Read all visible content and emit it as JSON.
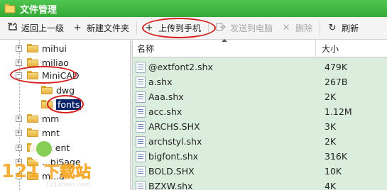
{
  "app": {
    "title": "文件管理"
  },
  "toolbar": {
    "back": {
      "icon": "back-icon",
      "label": "返回上一级"
    },
    "new_folder": {
      "icon": "plus-icon",
      "label": "新建文件夹"
    },
    "upload": {
      "icon": "plus-icon",
      "label": "上传到手机"
    },
    "send_pc": {
      "icon": "send-icon",
      "label": "发送到电脑"
    },
    "delete": {
      "icon": "close-icon",
      "label": "删除"
    },
    "refresh": {
      "icon": "refresh-icon",
      "label": "刷新"
    }
  },
  "tree": {
    "items": [
      {
        "label": "mihui",
        "expander": "+"
      },
      {
        "label": "miliao",
        "expander": "+"
      },
      {
        "label": "MiniCAD",
        "expander": "−"
      },
      {
        "label": "dwg",
        "expander": ""
      },
      {
        "label": "fonts",
        "expander": "",
        "selected": true
      },
      {
        "label": "mm",
        "expander": "+"
      },
      {
        "label": "mnt",
        "expander": "+"
      },
      {
        "label": "...cent",
        "expander": "+"
      },
      {
        "label": "...biSage",
        "expander": "+"
      },
      {
        "label": "m...a",
        "expander": "+"
      }
    ]
  },
  "files": {
    "columns": {
      "name": "名称",
      "size": "大小"
    },
    "rows": [
      {
        "name": "@extfont2.shx",
        "size": "479K"
      },
      {
        "name": "a.shx",
        "size": "267B"
      },
      {
        "name": "Aaa.shx",
        "size": "2K"
      },
      {
        "name": "acc.shx",
        "size": "1.12M"
      },
      {
        "name": "ARCHS.SHX",
        "size": "3K"
      },
      {
        "name": "archstyl.shx",
        "size": "2K"
      },
      {
        "name": "bigfont.shx",
        "size": "316K"
      },
      {
        "name": "BOLD.SHX",
        "size": "10K"
      },
      {
        "name": "BZXW.shx",
        "size": "4K"
      }
    ]
  },
  "watermark": {
    "text": "下载站",
    "url": "121down.com",
    "number": "121"
  },
  "colors": {
    "titlebar": "#3db33d",
    "highlight": "#d8201f",
    "list_bg": "#dbeede",
    "selection": "#0a246a"
  }
}
